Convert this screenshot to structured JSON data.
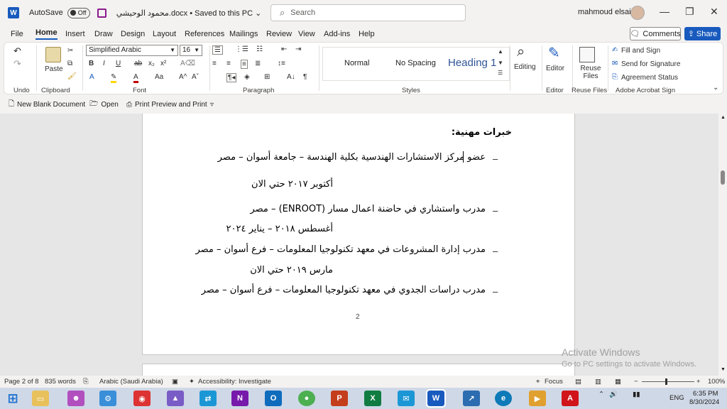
{
  "titlebar": {
    "autosave_label": "AutoSave",
    "autosave_state": "Off",
    "doc_title": "محمود الوحيشي.docx • Saved to this PC ⌄",
    "search_placeholder": "Search",
    "user_name": "mahmoud elsaid"
  },
  "tabs": [
    "File",
    "Home",
    "Insert",
    "Draw",
    "Design",
    "Layout",
    "References",
    "Mailings",
    "Review",
    "View",
    "Add-ins",
    "Help"
  ],
  "actions": {
    "comments": "Comments",
    "share": "Share"
  },
  "ribbon": {
    "undo_group": "Undo",
    "paste_label": "Paste",
    "clipboard_group": "Clipboard",
    "font_name": "Simplified Arabic",
    "font_size": "16",
    "font_group": "Font",
    "paragraph_group": "Paragraph",
    "styles": [
      "Normal",
      "No Spacing",
      "Heading 1"
    ],
    "styles_group": "Styles",
    "editing_label": "Editing",
    "editor_label": "Editor",
    "editor_group": "Editor",
    "reuse_files_label": "Reuse Files",
    "reuse_files_group": "Reuse Files",
    "fill_sign": "Fill and Sign",
    "send_signature": "Send for Signature",
    "agreement_status": "Agreement Status",
    "acrobat_group": "Adobe Acrobat Sign"
  },
  "qat": {
    "new_blank": "New Blank Document",
    "open": "Open",
    "print_preview": "Print Preview and Print"
  },
  "document": {
    "heading": "خبرات مهنية:",
    "lines": [
      "عضو مركز الاستشارات الهندسية بكلية الهندسة – جامعة أسوان – مصر",
      "أكتوبر ٢٠١٧ حتي الان",
      "مدرب واستشاري في حاضنة اعمال مسار (ENROOT) – مصر",
      "أغسطس ٢٠١٨ – يناير ٢٠٢٤",
      "مدرب إدارة المشروعات في معهد تكنولوجيا المعلومات – فرع أسوان – مصر",
      "مارس ٢٠١٩ حتي الان",
      "مدرب دراسات الجدوي في معهد تكنولوجيا المعلومات – فرع أسوان – مصر"
    ],
    "dash": "–",
    "page_number": "2"
  },
  "watermark": {
    "line1": "Activate Windows",
    "line2": "Go to PC settings to activate Windows."
  },
  "statusbar": {
    "page": "Page 2 of 8",
    "words": "835 words",
    "language": "Arabic (Saudi Arabia)",
    "accessibility": "Accessibility: Investigate",
    "focus": "Focus",
    "zoom": "100%"
  },
  "taskbar": {
    "lang": "ENG",
    "time": "6:35 PM",
    "date": "8/30/2024"
  },
  "colors": {
    "accent": "#185abd",
    "heading": "#2f5496"
  }
}
